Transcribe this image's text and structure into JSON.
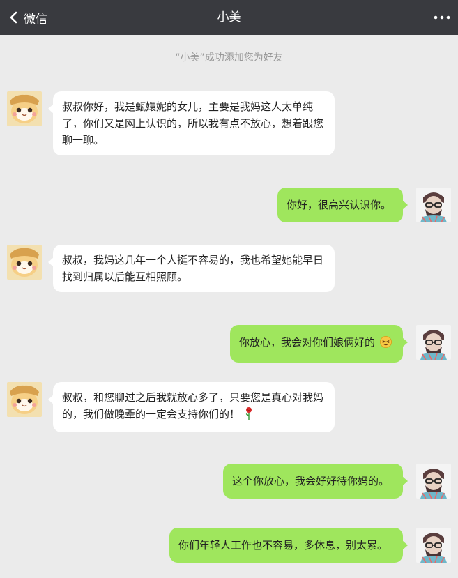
{
  "header": {
    "back_label": "微信",
    "title": "小美",
    "back_icon": "chevron-left-icon",
    "more_icon": "more-horizontal-icon"
  },
  "system_notice": "“小美”成功添加您为好友",
  "messages": [
    {
      "sender": "other",
      "text": "叔叔你好，我是甄嬛妮的女儿，主要是我妈这人太单纯了，你们又是网上认识的，所以我有点不放心，想着跟您聊一聊。"
    },
    {
      "sender": "self",
      "text": "你好，很高兴认识你。"
    },
    {
      "sender": "other",
      "text": "叔叔，我妈这几年一个人挺不容易的，我也希望她能早日找到归属以后能互相照顾。"
    },
    {
      "sender": "self",
      "text": "你放心，我会对你们娘俩好的",
      "emoji": "laughing-emoji"
    },
    {
      "sender": "other",
      "text": "叔叔，和您聊过之后我就放心多了，只要您是真心对我妈的，我们做晚辈的一定会支持你们的！",
      "emoji": "rose-emoji"
    },
    {
      "sender": "self",
      "text": "这个你放心，我会好好待你妈的。"
    },
    {
      "sender": "self",
      "text": "你们年轻人工作也不容易，多休息，别太累。"
    }
  ],
  "colors": {
    "topbar": "#393a3f",
    "background": "#ebebeb",
    "self_bubble": "#9fe65d",
    "other_bubble": "#ffffff"
  }
}
